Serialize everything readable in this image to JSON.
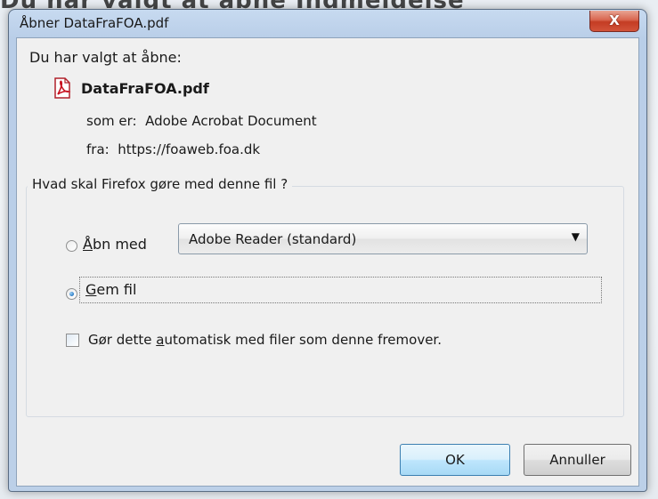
{
  "background": {
    "text": "Du har valgt at åbne Indmeldelse",
    "blur_text": "ddeleise"
  },
  "dialog": {
    "title": "Åbner DataFraFOA.pdf",
    "close_symbol": "X",
    "chosen_label": "Du har valgt at åbne:",
    "file_icon": "pdf-icon",
    "file_name": "DataFraFOA.pdf",
    "type_label": "som er:",
    "type_value": "Adobe Acrobat Document",
    "from_label": "fra:",
    "from_value": "https://foaweb.foa.dk",
    "group_label": "Hvad skal Firefox gøre med denne fil ?",
    "open_with": {
      "accesskey": "Å",
      "rest": "bn med",
      "selected": false
    },
    "app_select": {
      "value": "Adobe Reader  (standard)"
    },
    "save_file": {
      "accesskey": "G",
      "rest": "em fil",
      "selected": true
    },
    "auto_checkbox": {
      "before": "Gør dette ",
      "accesskey": "a",
      "after": "utomatisk med filer som denne fremover.",
      "checked": false
    },
    "ok_label": "OK",
    "cancel_label": "Annuller"
  },
  "colors": {
    "close_button": "#c43c23",
    "ok_border": "#3c7fb1"
  }
}
